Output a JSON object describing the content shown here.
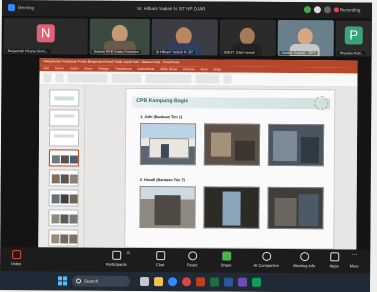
{
  "zoom": {
    "app_label": "Meeting",
    "window_title": "St. Hilbani Yadiah N. BT NP DJAR",
    "recording_label": "Recording",
    "colors": {
      "bar": "#1f1f1f",
      "accent": "#2d8cff",
      "end": "#e22e2e"
    }
  },
  "participants": [
    {
      "name": "Nurjannah Kirana Gunu...",
      "initial": "N",
      "color": "#e0627a",
      "type": "letter"
    },
    {
      "name": "Sadam PKE Kusto Purnomo",
      "type": "video"
    },
    {
      "name": "St Hilbani Yadiah N. BT",
      "type": "video"
    },
    {
      "name": "DMOT, Glam Ismail",
      "type": "video"
    },
    {
      "name": "Imelda Yudanti - BPS",
      "type": "video"
    },
    {
      "name": "Phanika Putri...",
      "initial": "P",
      "color": "#3aa37a",
      "type": "letter"
    }
  ],
  "ppt": {
    "window_title": "Rekapitulasi Pendataan Posko Bangunan Rumah Tidak Layak Huni - Bantuan Kab - PowerPoint",
    "menu": [
      "File",
      "Home",
      "Insert",
      "Draw",
      "Design",
      "Transitions",
      "Animations",
      "Slide Show",
      "Review",
      "View",
      "Help"
    ],
    "slide_numbers": [
      "",
      "",
      "",
      "",
      "",
      "",
      "",
      "",
      ""
    ],
    "slide": {
      "title": "CPB Kampung Bagis",
      "caption_1": "1. Jidri (Bantuan Tim 1)",
      "caption_2": "2. Hasall (Bantuan Tim 7)"
    }
  },
  "toolbar": {
    "video": "Video",
    "participants": "Participants",
    "participants_count": "15",
    "chat": "Chat",
    "react": "React",
    "share": "Share",
    "ai": "AI Companion",
    "meeting_info": "Meeting info",
    "apps": "Apps",
    "more": "More"
  },
  "taskbar": {
    "search_placeholder": "Search"
  }
}
